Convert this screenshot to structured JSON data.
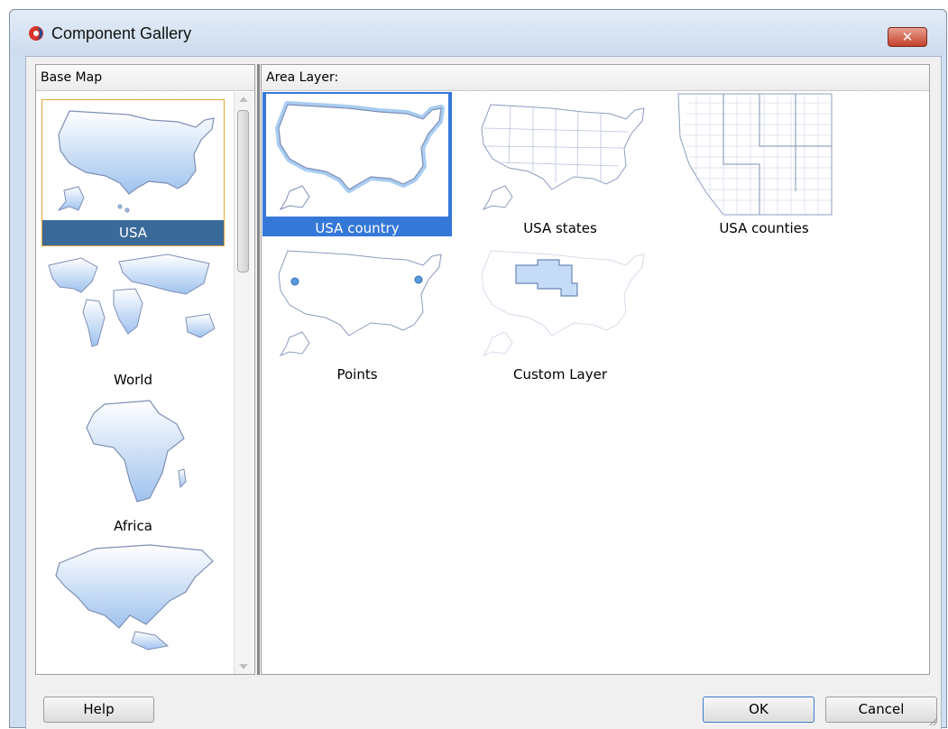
{
  "window": {
    "title": "Component Gallery",
    "close_label": "✕"
  },
  "base_map": {
    "header": "Base Map",
    "items": [
      {
        "label": "USA",
        "selected": true
      },
      {
        "label": "World",
        "selected": false
      },
      {
        "label": "Africa",
        "selected": false
      },
      {
        "label": "",
        "selected": false
      }
    ]
  },
  "area_layer": {
    "header": "Area Layer:",
    "items": [
      {
        "label": "USA country",
        "selected": true
      },
      {
        "label": "USA states",
        "selected": false
      },
      {
        "label": "USA counties",
        "selected": false
      },
      {
        "label": "Points",
        "selected": false
      },
      {
        "label": "Custom Layer",
        "selected": false
      }
    ]
  },
  "buttons": {
    "help": "Help",
    "ok": "OK",
    "cancel": "Cancel"
  },
  "colors": {
    "selection": "#3578d8",
    "base_selection": "#3a6a99",
    "map_fill": "#c8dcf4",
    "map_stroke": "#7d8fb5"
  }
}
